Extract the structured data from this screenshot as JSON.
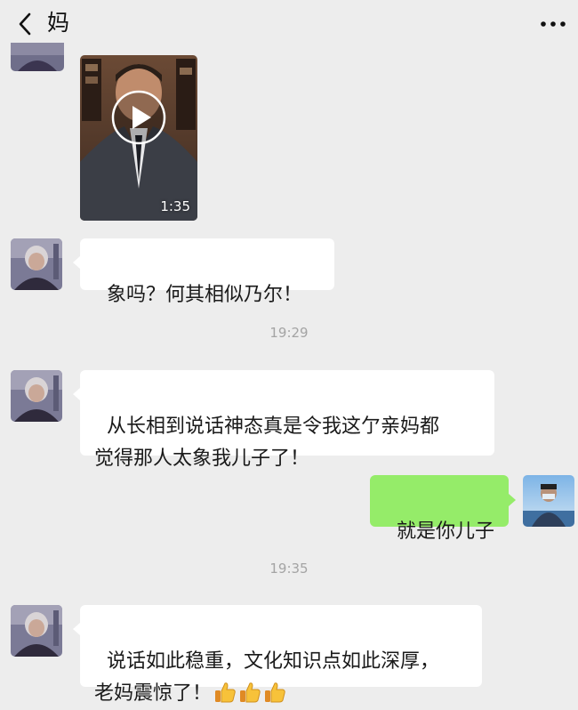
{
  "header": {
    "title": "妈",
    "back_icon": "chevron-left-icon",
    "more_icon": "more-dots-icon"
  },
  "video_message": {
    "duration": "1:35",
    "play_icon": "play-icon"
  },
  "messages": [
    {
      "sender": "mom",
      "text": "象吗？何其相似乃尔！"
    },
    {
      "sender": "mom",
      "text": "从长相到说话神态真是令我这亇亲妈都\n觉得那人太象我儿子了！"
    },
    {
      "sender": "me",
      "text": "就是你儿子"
    },
    {
      "sender": "mom",
      "text": "说话如此稳重，文化知识点如此深厚，\n老妈震惊了！"
    }
  ],
  "timestamps": [
    "19:29",
    "19:35"
  ],
  "emoji": {
    "name": "thumbs-up",
    "count": 3
  },
  "colors": {
    "background": "#ededed",
    "bubble_incoming": "#ffffff",
    "bubble_outgoing": "#95ec69",
    "timestamp": "#a4a4a4"
  }
}
